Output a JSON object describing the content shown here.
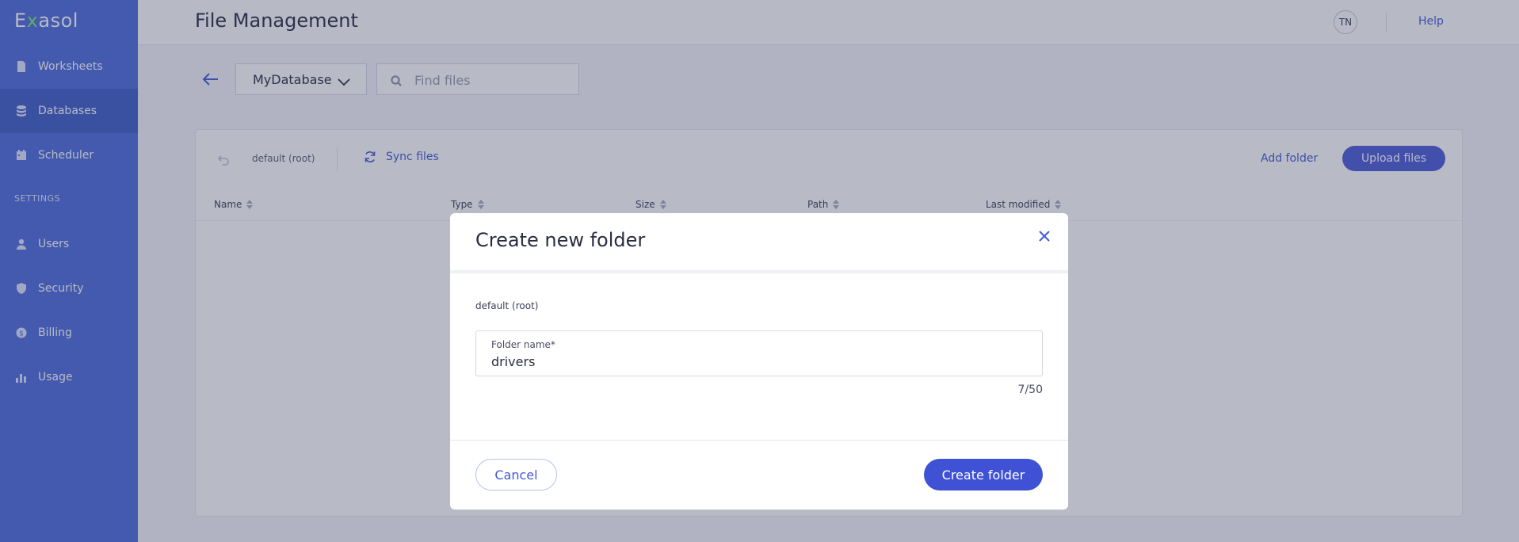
{
  "app": {
    "logo_prefix": "E",
    "logo_accent": "x",
    "logo_suffix": "asol"
  },
  "sidebar": {
    "items": [
      {
        "label": "Worksheets",
        "icon": "document-icon"
      },
      {
        "label": "Databases",
        "icon": "database-icon",
        "active": true
      },
      {
        "label": "Scheduler",
        "icon": "calendar-icon"
      }
    ],
    "settings_label": "SETTINGS",
    "settings_items": [
      {
        "label": "Users",
        "icon": "user-icon"
      },
      {
        "label": "Security",
        "icon": "shield-icon"
      },
      {
        "label": "Billing",
        "icon": "dollar-icon"
      },
      {
        "label": "Usage",
        "icon": "bar-chart-icon"
      }
    ]
  },
  "header": {
    "title": "File Management",
    "avatar_initials": "TN",
    "help_label": "Help"
  },
  "toolbar": {
    "database": "MyDatabase",
    "search_placeholder": "Find files"
  },
  "files": {
    "breadcrumb": "default (root)",
    "sync_label": "Sync files",
    "add_folder_label": "Add folder",
    "upload_label": "Upload files",
    "columns": [
      "Name",
      "Type",
      "Size",
      "Path",
      "Last modified"
    ]
  },
  "modal": {
    "title": "Create new folder",
    "path": "default (root)",
    "field_label": "Folder name*",
    "field_value": "drivers",
    "counter": "7/50",
    "cancel_label": "Cancel",
    "create_label": "Create folder"
  },
  "colors": {
    "sidebar_bg": "#4c6cdb",
    "accent": "#4459d4",
    "primary_button": "#3f51d4",
    "logo_accent": "#7fe36b"
  }
}
